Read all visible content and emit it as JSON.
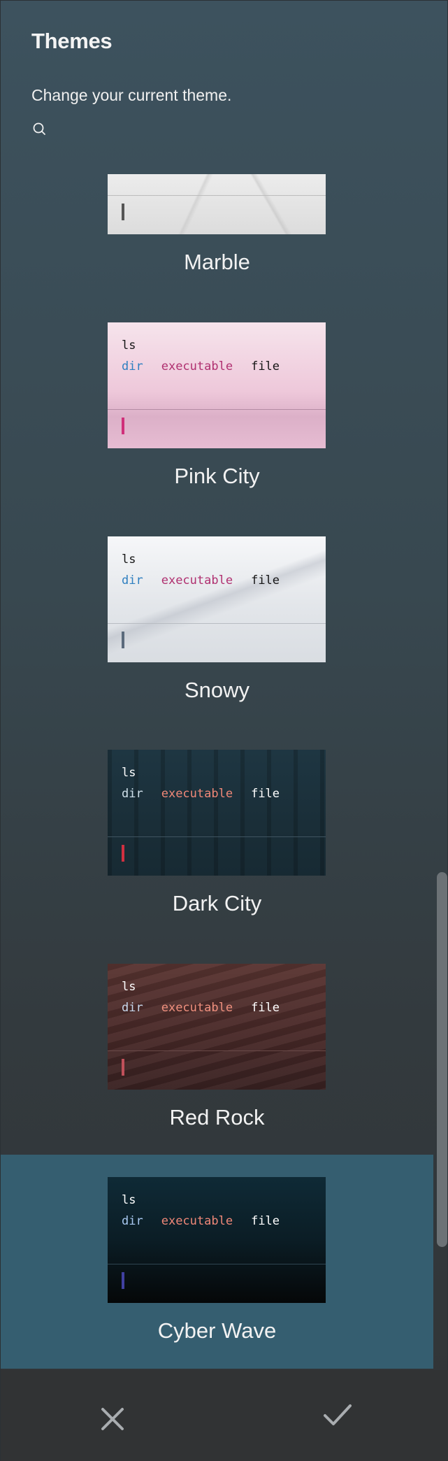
{
  "header": {
    "title": "Themes",
    "subtitle": "Change your current theme."
  },
  "terminal": {
    "cmd": "ls",
    "dir": "dir",
    "exe": "executable",
    "file": "file"
  },
  "themes": [
    {
      "name": "Marble",
      "selected": false,
      "cursor_color": "#555555"
    },
    {
      "name": "Pink City",
      "selected": false,
      "dir_color": "#2f7fc0",
      "exe_color": "#b03070",
      "file_color": "#151515",
      "cmd_color": "#151515",
      "cursor_color": "#d0307a"
    },
    {
      "name": "Snowy",
      "selected": false,
      "dir_color": "#2f7fc0",
      "exe_color": "#b03070",
      "file_color": "#151515",
      "cmd_color": "#151515",
      "cursor_color": "#5b6a7c"
    },
    {
      "name": "Dark City",
      "selected": false,
      "dir_color": "#cfe0ea",
      "exe_color": "#f08878",
      "file_color": "#ffffff",
      "cmd_color": "#ffffff",
      "cursor_color": "#d03040"
    },
    {
      "name": "Red Rock",
      "selected": false,
      "dir_color": "#c8d8ec",
      "exe_color": "#f0907e",
      "file_color": "#ffffff",
      "cmd_color": "#ffffff",
      "cursor_color": "#c0505a"
    },
    {
      "name": "Cyber Wave",
      "selected": true,
      "dir_color": "#a8c8f0",
      "exe_color": "#f08878",
      "file_color": "#ffffff",
      "cmd_color": "#ffffff",
      "cursor_color": "#4040a0"
    }
  ],
  "colors": {
    "selected_bg": "#355e70",
    "footer_bg": "#313334",
    "icon_color": "#a9adb0"
  },
  "icons": {
    "search": "search-icon",
    "cancel": "close-icon",
    "confirm": "check-icon"
  }
}
